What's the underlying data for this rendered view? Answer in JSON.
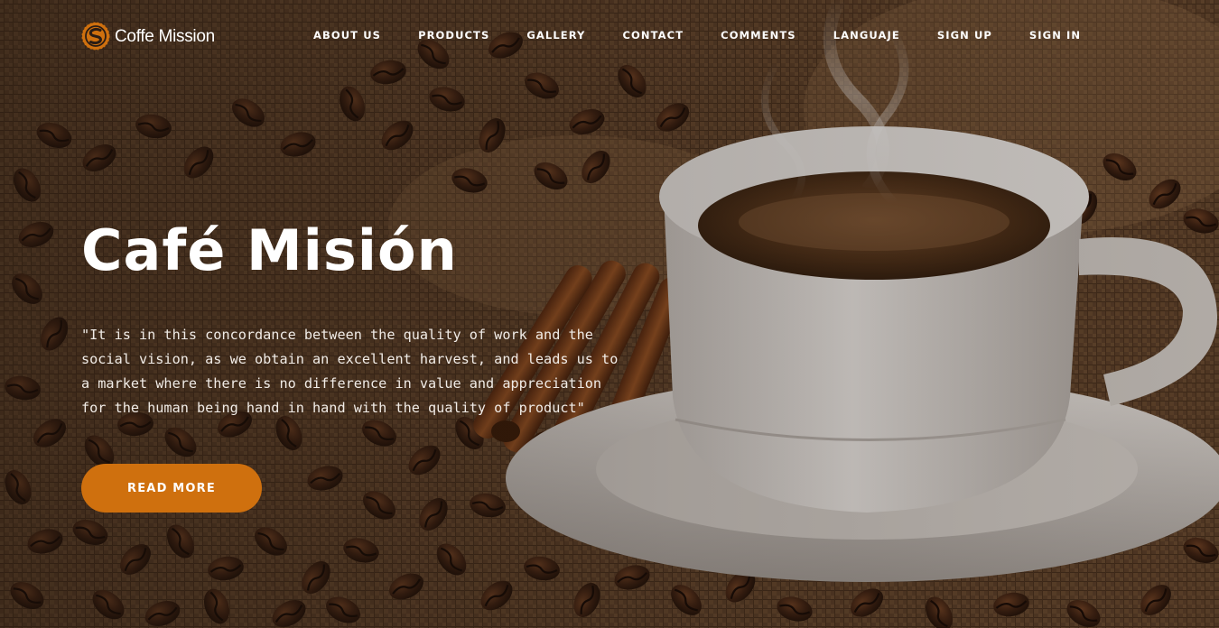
{
  "brand": {
    "name": "Coffe Mission",
    "accent_color": "#cf700e"
  },
  "nav": {
    "items": [
      {
        "label": "ABOUT US"
      },
      {
        "label": "PRODUCTS"
      },
      {
        "label": "GALLERY"
      },
      {
        "label": "CONTACT"
      },
      {
        "label": "COMMENTS"
      },
      {
        "label": "LANGUAJE"
      },
      {
        "label": "SIGN UP"
      },
      {
        "label": "SIGN IN"
      }
    ]
  },
  "hero": {
    "title": "Café Misión",
    "quote": "\"It is in this concordance between the quality of work and the\nsocial vision, as we obtain an excellent harvest, and leads us to\na market where there is no difference in value and appreciation\nfor the human being hand in hand with the quality of product\"",
    "cta_label": "READ MORE",
    "background": "coffee-cup-with-beans-and-cinnamon-image"
  }
}
